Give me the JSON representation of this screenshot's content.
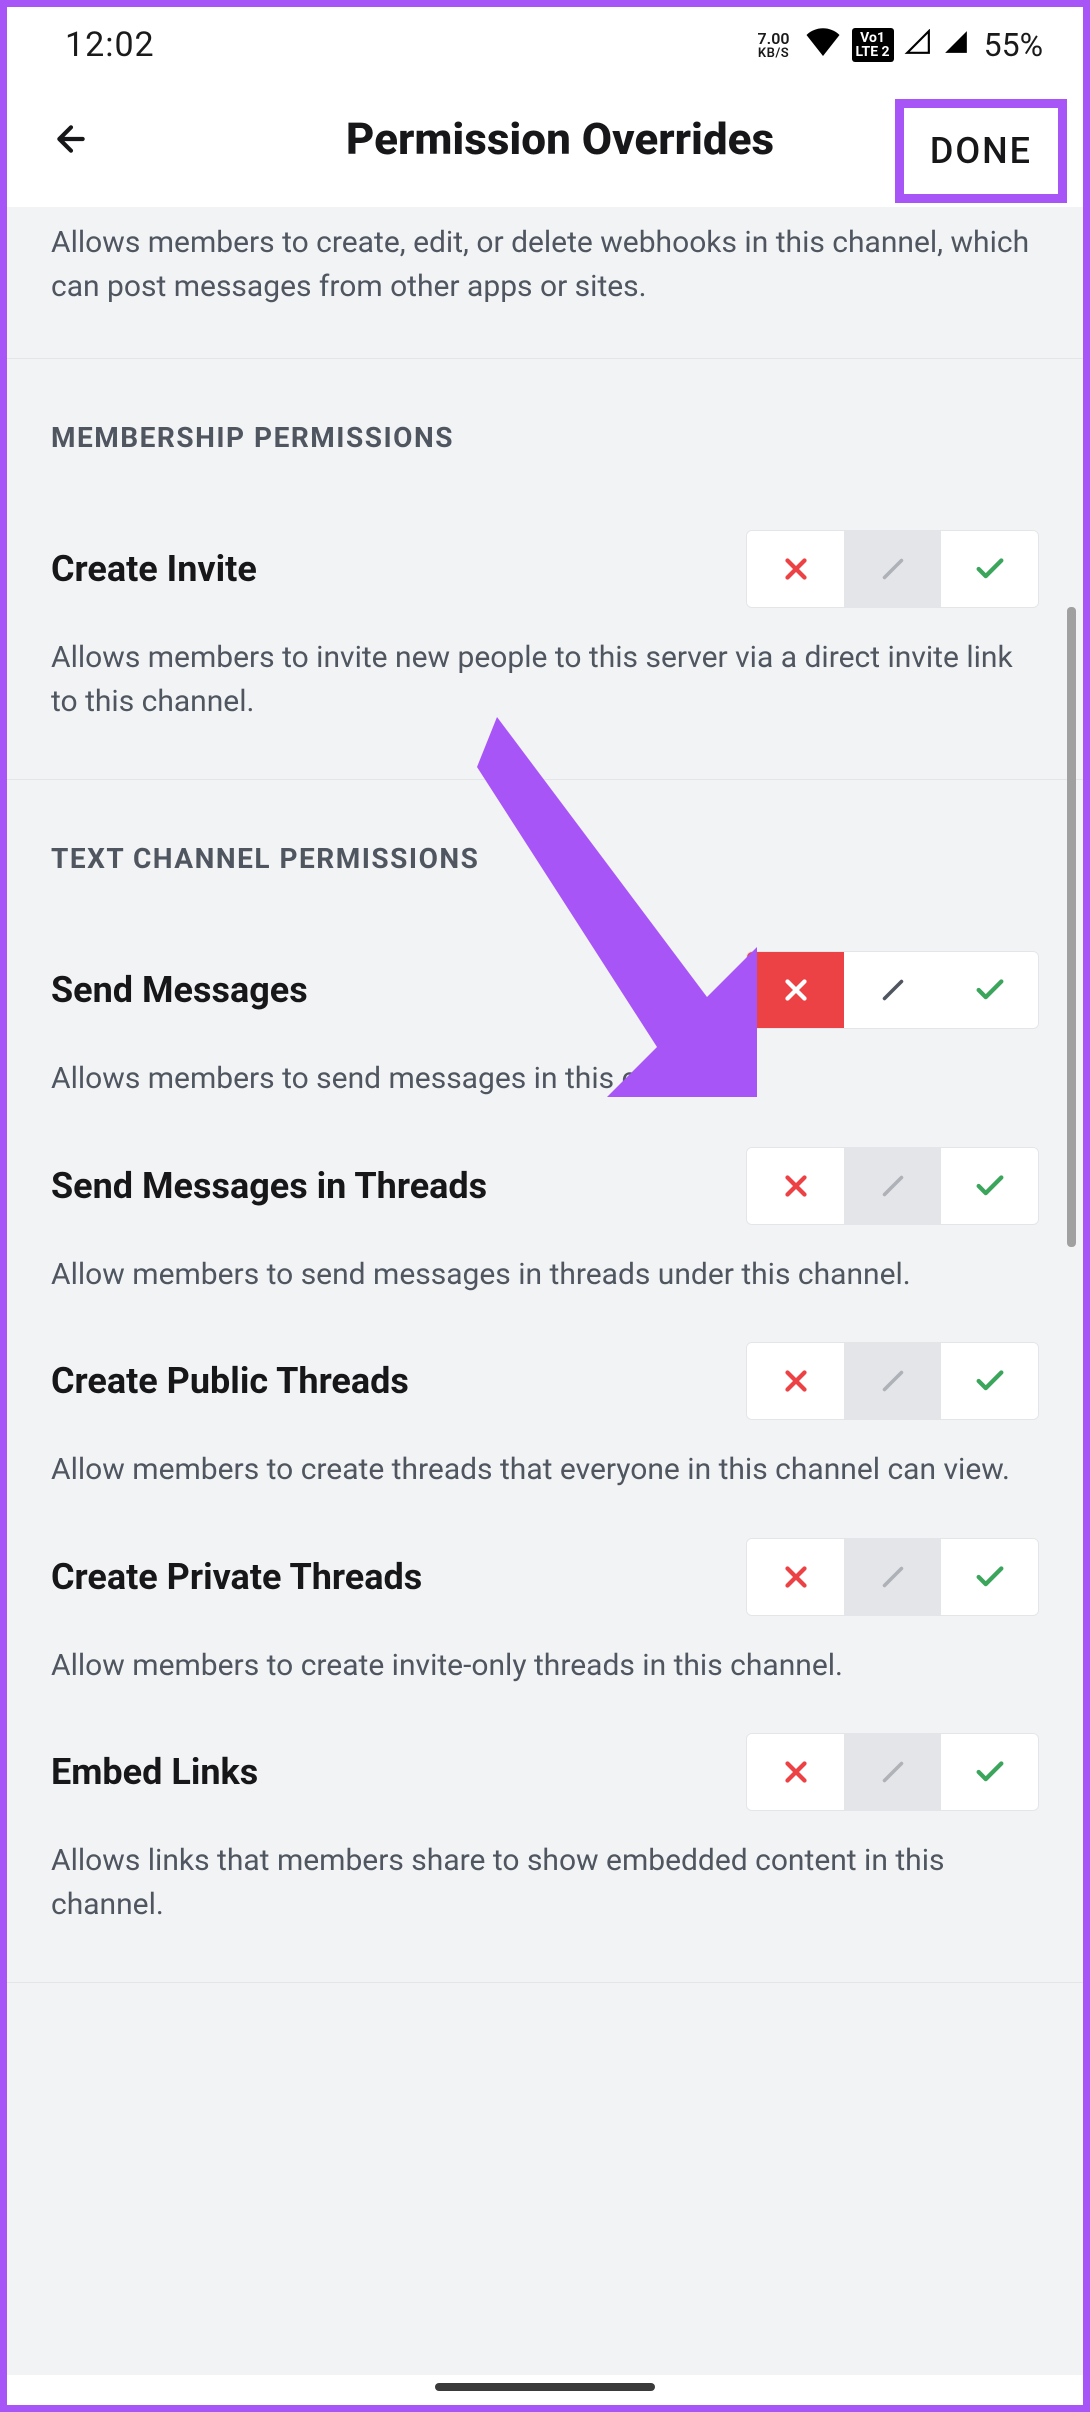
{
  "status_bar": {
    "time": "12:02",
    "kbs_rate": "7.00",
    "kbs_label": "KB/S",
    "lte_top": "Vo1",
    "lte_bot": "LTE 2",
    "battery": "55%"
  },
  "header": {
    "title": "Permission Overrides",
    "done": "DONE"
  },
  "intro": {
    "desc": "Allows members to create, edit, or delete webhooks in this channel, which can post messages from other apps or sites."
  },
  "sections": {
    "membership": {
      "label": "MEMBERSHIP PERMISSIONS"
    },
    "text_channel": {
      "label": "TEXT CHANNEL PERMISSIONS"
    }
  },
  "permissions": {
    "create_invite": {
      "title": "Create Invite",
      "desc": "Allows members to invite new people to this server via a direct invite link to this channel.",
      "state": "neutral"
    },
    "send_messages": {
      "title": "Send Messages",
      "desc": "Allows members to send messages in this channel.",
      "state": "deny"
    },
    "send_messages_threads": {
      "title": "Send Messages in Threads",
      "desc": "Allow members to send messages in threads under this channel.",
      "state": "neutral"
    },
    "create_public_threads": {
      "title": "Create Public Threads",
      "desc": "Allow members to create threads that everyone in this channel can view.",
      "state": "neutral"
    },
    "create_private_threads": {
      "title": "Create Private Threads",
      "desc": "Allow members to create invite-only threads in this channel.",
      "state": "neutral"
    },
    "embed_links": {
      "title": "Embed Links",
      "desc": "Allows links that members share to show embedded content in this channel.",
      "state": "neutral"
    }
  }
}
